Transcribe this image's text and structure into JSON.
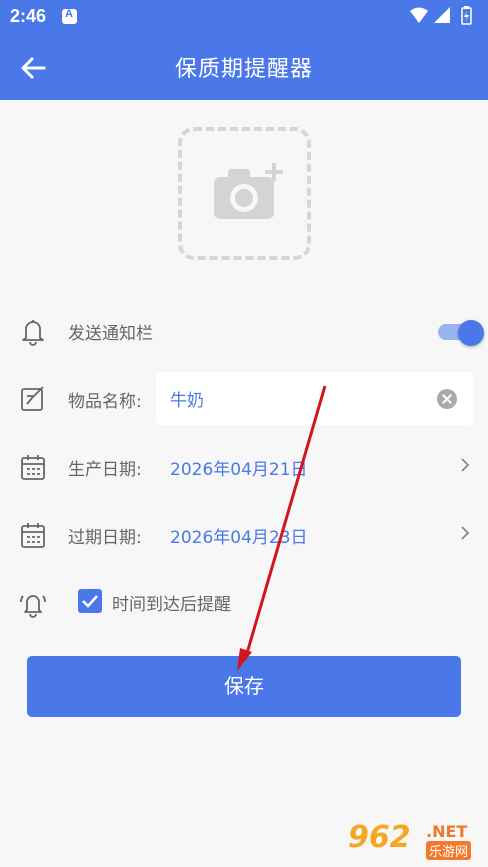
{
  "status_bar": {
    "time": "2:46"
  },
  "app_bar": {
    "title": "保质期提醒器"
  },
  "form": {
    "notify": {
      "label": "发送通知栏",
      "enabled": true
    },
    "item_name": {
      "label": "物品名称:",
      "value": "牛奶"
    },
    "production_date": {
      "label": "生产日期:",
      "value": "2026年04月21日"
    },
    "expiry_date": {
      "label": "过期日期:",
      "value": "2026年04月23日"
    },
    "remind_after": {
      "label": "时间到达后提醒",
      "checked": true
    }
  },
  "save_button": {
    "label": "保存"
  },
  "watermark": {
    "logo": "962",
    "suffix": ".NET",
    "site": "乐游网"
  },
  "colors": {
    "accent": "#4a78e8",
    "annotation_arrow": "#d0161c"
  }
}
